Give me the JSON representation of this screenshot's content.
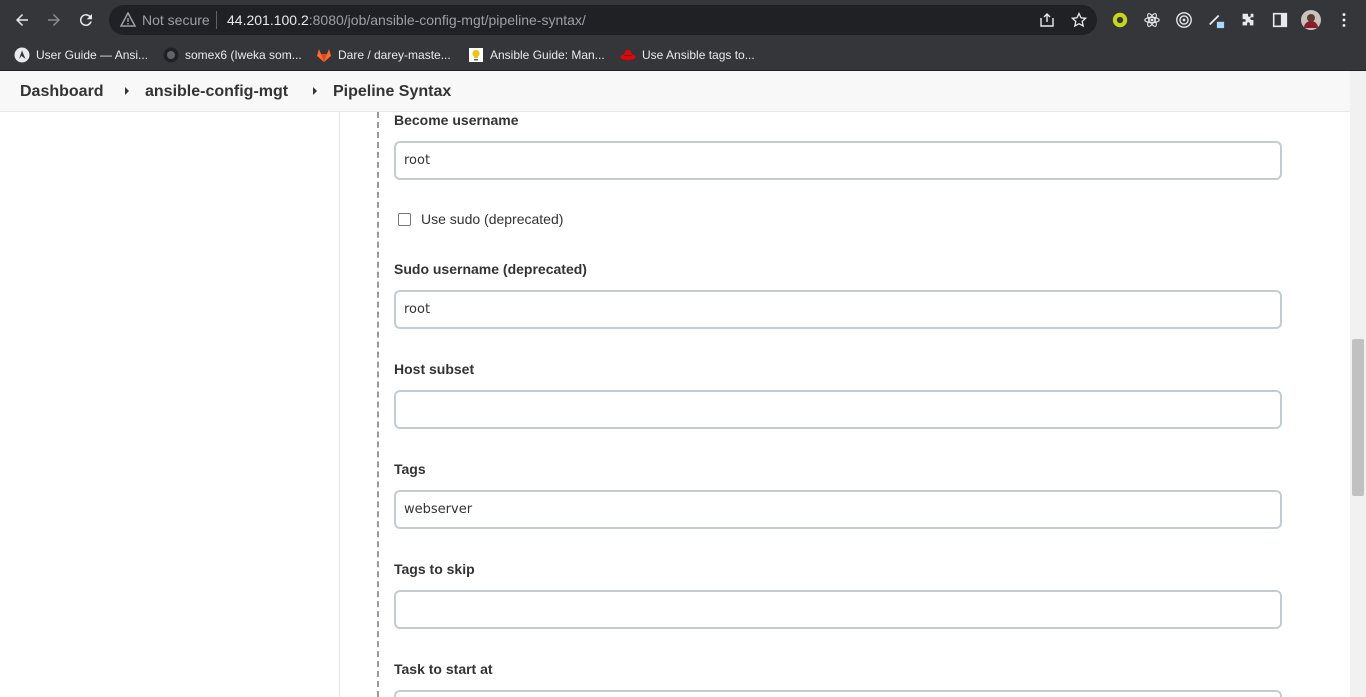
{
  "browser": {
    "security_label": "Not secure",
    "url_host": "44.201.100.2",
    "url_rest": ":8080/job/ansible-config-mgt/pipeline-syntax/"
  },
  "bookmarks": [
    {
      "label": "User Guide — Ansi...",
      "icon": "ansible-icon"
    },
    {
      "label": "somex6 (Iweka som...",
      "icon": "github-icon"
    },
    {
      "label": "Dare / darey-maste...",
      "icon": "gitlab-icon"
    },
    {
      "label": "Ansible Guide: Man...",
      "icon": "bulb-icon"
    },
    {
      "label": "Use Ansible tags to...",
      "icon": "redhat-icon"
    }
  ],
  "breadcrumb": {
    "items": [
      "Dashboard",
      "ansible-config-mgt",
      "Pipeline Syntax"
    ]
  },
  "form": {
    "become_username_label": "Become username",
    "become_username_value": "root",
    "use_sudo_label": "Use sudo (deprecated)",
    "sudo_username_label": "Sudo username (deprecated)",
    "sudo_username_value": "root",
    "host_subset_label": "Host subset",
    "host_subset_value": "",
    "tags_label": "Tags",
    "tags_value": "webserver",
    "tags_to_skip_label": "Tags to skip",
    "tags_to_skip_value": "",
    "task_to_start_label": "Task to start at"
  },
  "colors": {
    "chrome": "#35363a",
    "omnibox": "#202124",
    "field_border": "#c3ccd1"
  }
}
